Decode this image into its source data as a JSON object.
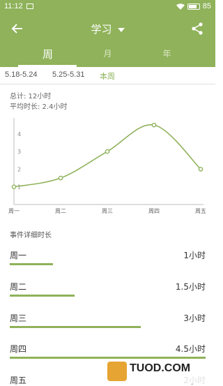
{
  "status": {
    "time": "11:12",
    "battery": "85"
  },
  "header": {
    "title": "学习"
  },
  "tabs": [
    {
      "label": "周"
    },
    {
      "label": "月"
    },
    {
      "label": "年"
    }
  ],
  "weeks": [
    {
      "label": "5.18-5.24"
    },
    {
      "label": "5.25-5.31"
    },
    {
      "label": "本周"
    }
  ],
  "summary": {
    "total": "总计: 12小时",
    "average": "平均时长: 2.4小时"
  },
  "chart_data": {
    "type": "line",
    "categories": [
      "周一",
      "周二",
      "周三",
      "周四",
      "周五"
    ],
    "values": [
      1,
      1.5,
      3,
      4.5,
      2
    ],
    "y_ticks": [
      "1",
      "2",
      "3",
      "4"
    ],
    "ylim": [
      0,
      4.9
    ],
    "grid": false,
    "color": "#8fb25a"
  },
  "details": {
    "title": "事件详细时长",
    "rows": [
      {
        "day": "周一",
        "value": "1小时",
        "fraction": 0.22
      },
      {
        "day": "周二",
        "value": "1.5小时",
        "fraction": 0.33
      },
      {
        "day": "周三",
        "value": "3小时",
        "fraction": 0.67
      },
      {
        "day": "周四",
        "value": "4.5小时",
        "fraction": 1.0
      },
      {
        "day": "周五",
        "value": "2小时",
        "fraction": 0.44
      }
    ]
  },
  "watermark": {
    "text": "TUOD.COM"
  },
  "colors": {
    "accent": "#8fb25a"
  }
}
